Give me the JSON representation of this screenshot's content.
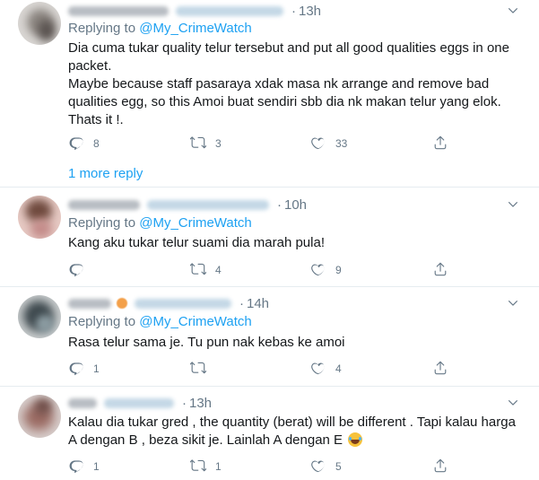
{
  "reply_prefix": "Replying to",
  "tweets": [
    {
      "time": "13h",
      "reply_handle": "@My_CrimeWatch",
      "lines": [
        "Dia cuma tukar quality telur tersebut and put all good qualities eggs in one",
        "packet.",
        "Maybe because  staff pasaraya xdak masa nk arrange and remove bad",
        "qualities egg, so this Amoi buat sendiri sbb dia nk makan telur yang elok.",
        "Thats it !."
      ],
      "replies": "8",
      "retweets": "3",
      "likes": "33",
      "more_reply": "1 more reply"
    },
    {
      "time": "10h",
      "reply_handle": "@My_CrimeWatch",
      "lines": [
        "Kang aku tukar telur suami dia marah pula!"
      ],
      "replies": "",
      "retweets": "4",
      "likes": "9"
    },
    {
      "time": "14h",
      "reply_handle": "@My_CrimeWatch",
      "lines": [
        "Rasa telur sama je. Tu pun nak kebas ke amoi"
      ],
      "replies": "1",
      "retweets": "",
      "likes": "4"
    },
    {
      "time": "13h",
      "lines": [
        "Kalau dia tukar gred , the quantity (berat) will be different . Tapi kalau harga",
        "A dengan B , beza sikit je.  Lainlah A dengan E"
      ],
      "replies": "1",
      "retweets": "1",
      "likes": "5"
    }
  ],
  "icons": {
    "reply": "reply-icon",
    "retweet": "retweet-icon",
    "like": "heart-icon",
    "share": "share-icon",
    "caret": "chevron-down-icon",
    "emoji": "face-with-tears-of-joy-emoji"
  },
  "colors": {
    "link": "#1da1f2",
    "secondary": "#657786",
    "text": "#14171a",
    "divider": "#e6ecf0"
  }
}
